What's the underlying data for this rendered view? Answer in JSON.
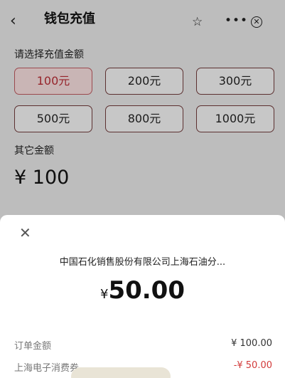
{
  "header": {
    "back_icon": "chevron-left-icon",
    "title": "钱包充值",
    "actions": [
      "star-icon",
      "more-icon",
      "close-circle-icon"
    ]
  },
  "recharge": {
    "prompt": "请选择充值金额",
    "amounts": [
      "100元",
      "200元",
      "300元",
      "500元",
      "800元",
      "1000元"
    ],
    "selected_index": 0,
    "other_label": "其它金额",
    "other_value": "¥ 100"
  },
  "payment_sheet": {
    "close_icon": "close-icon",
    "merchant": "中国石化销售股份有限公司上海石油分...",
    "currency_symbol": "¥",
    "pay_amount": "50.00",
    "rows": [
      {
        "label": "订单金额",
        "value": "¥ 100.00"
      },
      {
        "label": "上海电子消费券",
        "value": "-¥ 50.00"
      }
    ]
  },
  "colors": {
    "accent_red": "#b32c34",
    "discount_red": "#d23a3a"
  }
}
